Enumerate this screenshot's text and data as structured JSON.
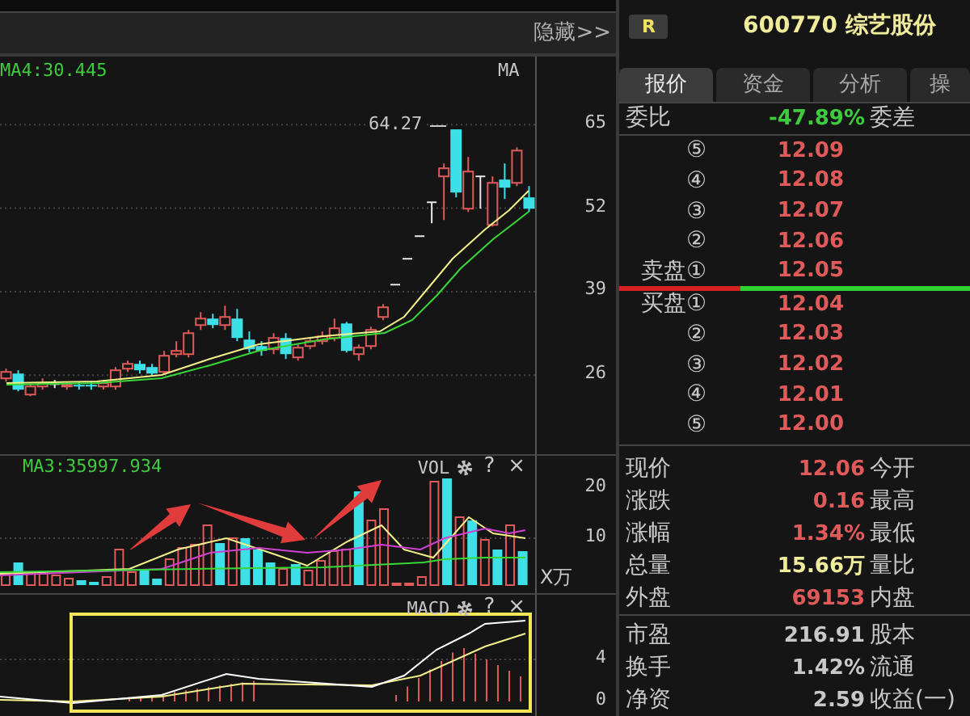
{
  "toolbar": {
    "hide_button": "隐藏>>"
  },
  "price_chart": {
    "ma_label": "MA4:30.445",
    "indicator": "MA",
    "high_marker": "64.27",
    "chart_data": {
      "type": "candlestick",
      "categories": [
        null,
        null,
        null,
        null,
        null,
        null,
        null,
        null,
        null,
        null,
        null,
        null,
        null,
        null,
        null,
        null,
        null,
        null,
        null,
        null,
        null,
        null,
        null,
        null,
        null,
        null,
        null,
        null,
        null,
        null,
        null,
        null,
        null,
        null,
        null,
        null,
        null,
        null,
        null,
        null,
        null,
        null,
        null,
        null
      ],
      "grid": true,
      "ylim": [
        13.7,
        75.6
      ],
      "yticks": [
        {
          "value": 26,
          "label": "26"
        },
        {
          "value": 39,
          "label": "39"
        },
        {
          "value": 52,
          "label": "52"
        },
        {
          "value": 65,
          "label": "65"
        }
      ],
      "ohlc": [
        [
          25.5,
          27.01,
          25.0,
          26.51
        ],
        [
          26.25,
          26.76,
          23.49,
          23.74
        ],
        [
          22.98,
          24.74,
          22.73,
          24.24
        ],
        [
          24.24,
          25.5,
          23.74,
          24.74
        ],
        [
          24.6,
          25.25,
          23.99,
          24.6
        ],
        [
          24.24,
          25.0,
          23.74,
          24.49
        ],
        [
          24.49,
          25.0,
          23.74,
          24.24
        ],
        [
          24.49,
          25.0,
          23.74,
          24.24
        ],
        [
          24.24,
          25.25,
          23.74,
          24.74
        ],
        [
          24.24,
          27.26,
          23.74,
          26.76
        ],
        [
          27.01,
          28.27,
          26.51,
          27.76
        ],
        [
          27.76,
          28.27,
          26.25,
          26.76
        ],
        [
          27.26,
          27.76,
          26.0,
          26.25
        ],
        [
          26.51,
          29.78,
          26.25,
          29.02
        ],
        [
          29.27,
          31.29,
          28.77,
          29.78
        ],
        [
          29.27,
          33.05,
          28.77,
          32.54
        ],
        [
          33.8,
          35.81,
          33.05,
          34.81
        ],
        [
          34.81,
          35.56,
          33.3,
          33.8
        ],
        [
          33.8,
          36.82,
          33.05,
          35.06
        ],
        [
          34.81,
          36.32,
          31.29,
          31.79
        ],
        [
          31.54,
          32.8,
          29.53,
          30.03
        ],
        [
          30.53,
          31.29,
          29.02,
          29.78
        ],
        [
          30.03,
          32.54,
          29.27,
          31.79
        ],
        [
          31.79,
          32.54,
          28.52,
          29.27
        ],
        [
          28.77,
          30.78,
          28.27,
          30.28
        ],
        [
          30.53,
          31.79,
          30.03,
          31.29
        ],
        [
          31.29,
          32.8,
          30.78,
          32.04
        ],
        [
          31.79,
          34.81,
          31.29,
          33.3
        ],
        [
          34.05,
          34.3,
          29.53,
          29.78
        ],
        [
          29.27,
          30.78,
          28.27,
          30.28
        ],
        [
          30.53,
          33.55,
          30.03,
          33.05
        ],
        [
          35.06,
          37.07,
          34.56,
          36.57
        ],
        [
          40.09,
          40.09,
          40.09,
          40.09
        ],
        [
          44.12,
          44.12,
          44.12,
          44.12
        ],
        [
          47.64,
          47.64,
          47.64,
          47.64
        ],
        [
          52.92,
          52.92,
          49.65,
          52.92
        ],
        [
          56.95,
          58.96,
          50.16,
          58.21
        ],
        [
          64.27,
          64.27,
          53.68,
          54.43
        ],
        [
          51.92,
          59.97,
          51.41,
          57.7
        ],
        [
          56.95,
          56.95,
          51.92,
          56.95
        ],
        [
          49.4,
          56.95,
          49.15,
          55.94
        ],
        [
          56.45,
          58.96,
          53.43,
          55.19
        ],
        [
          55.94,
          61.48,
          55.44,
          60.97
        ],
        [
          53.68,
          55.44,
          51.41,
          51.92
        ]
      ]
    }
  },
  "volume_chart": {
    "ma_label": "MA3:35997.934",
    "indicator": "VOL",
    "help": "?",
    "close": "×",
    "y_labels": [
      "20",
      "10"
    ],
    "unit": "X万"
  },
  "macd_chart": {
    "indicator": "MACD",
    "help": "?",
    "close": "×",
    "y_labels": [
      "4",
      "0"
    ]
  },
  "quote": {
    "badge": "R",
    "title": "600770 综艺股份",
    "tabs": [
      {
        "label": "报价",
        "selected": true
      },
      {
        "label": "资金",
        "selected": false
      },
      {
        "label": "分析",
        "selected": false
      },
      {
        "label": "操",
        "selected": false
      }
    ],
    "ratio": {
      "label": "委比",
      "value": "-47.89%",
      "label2": "委差"
    },
    "asks": [
      {
        "label": "⑤",
        "price": "12.09"
      },
      {
        "label": "④",
        "price": "12.08"
      },
      {
        "label": "③",
        "price": "12.07"
      },
      {
        "label": "②",
        "price": "12.06"
      },
      {
        "label": "卖盘①",
        "price": "12.05"
      }
    ],
    "bids": [
      {
        "label": "买盘①",
        "price": "12.04"
      },
      {
        "label": "②",
        "price": "12.03"
      },
      {
        "label": "③",
        "price": "12.02"
      },
      {
        "label": "④",
        "price": "12.01"
      },
      {
        "label": "⑤",
        "price": "12.00"
      }
    ],
    "trade_stats": [
      {
        "label": "现价",
        "value": "12.06",
        "label2": "今开",
        "color": "#e05a5a"
      },
      {
        "label": "涨跌",
        "value": "0.16",
        "label2": "最高",
        "color": "#e05a5a"
      },
      {
        "label": "涨幅",
        "value": "1.34%",
        "label2": "最低",
        "color": "#e05a5a"
      },
      {
        "label": "总量",
        "value": "15.66万",
        "label2": "量比",
        "color": "#f0ec9c"
      },
      {
        "label": "外盘",
        "value": "69153",
        "label2": "内盘",
        "color": "#e05a5a"
      }
    ],
    "valuation_stats": [
      {
        "label": "市盈",
        "value": "216.91",
        "label2": "股本",
        "color": "#c8c8c8"
      },
      {
        "label": "换手",
        "value": "1.42%",
        "label2": "流通",
        "color": "#c8c8c8"
      },
      {
        "label": "净资",
        "value": "2.59",
        "label2": "收益(一)",
        "color": "#c8c8c8"
      }
    ]
  }
}
